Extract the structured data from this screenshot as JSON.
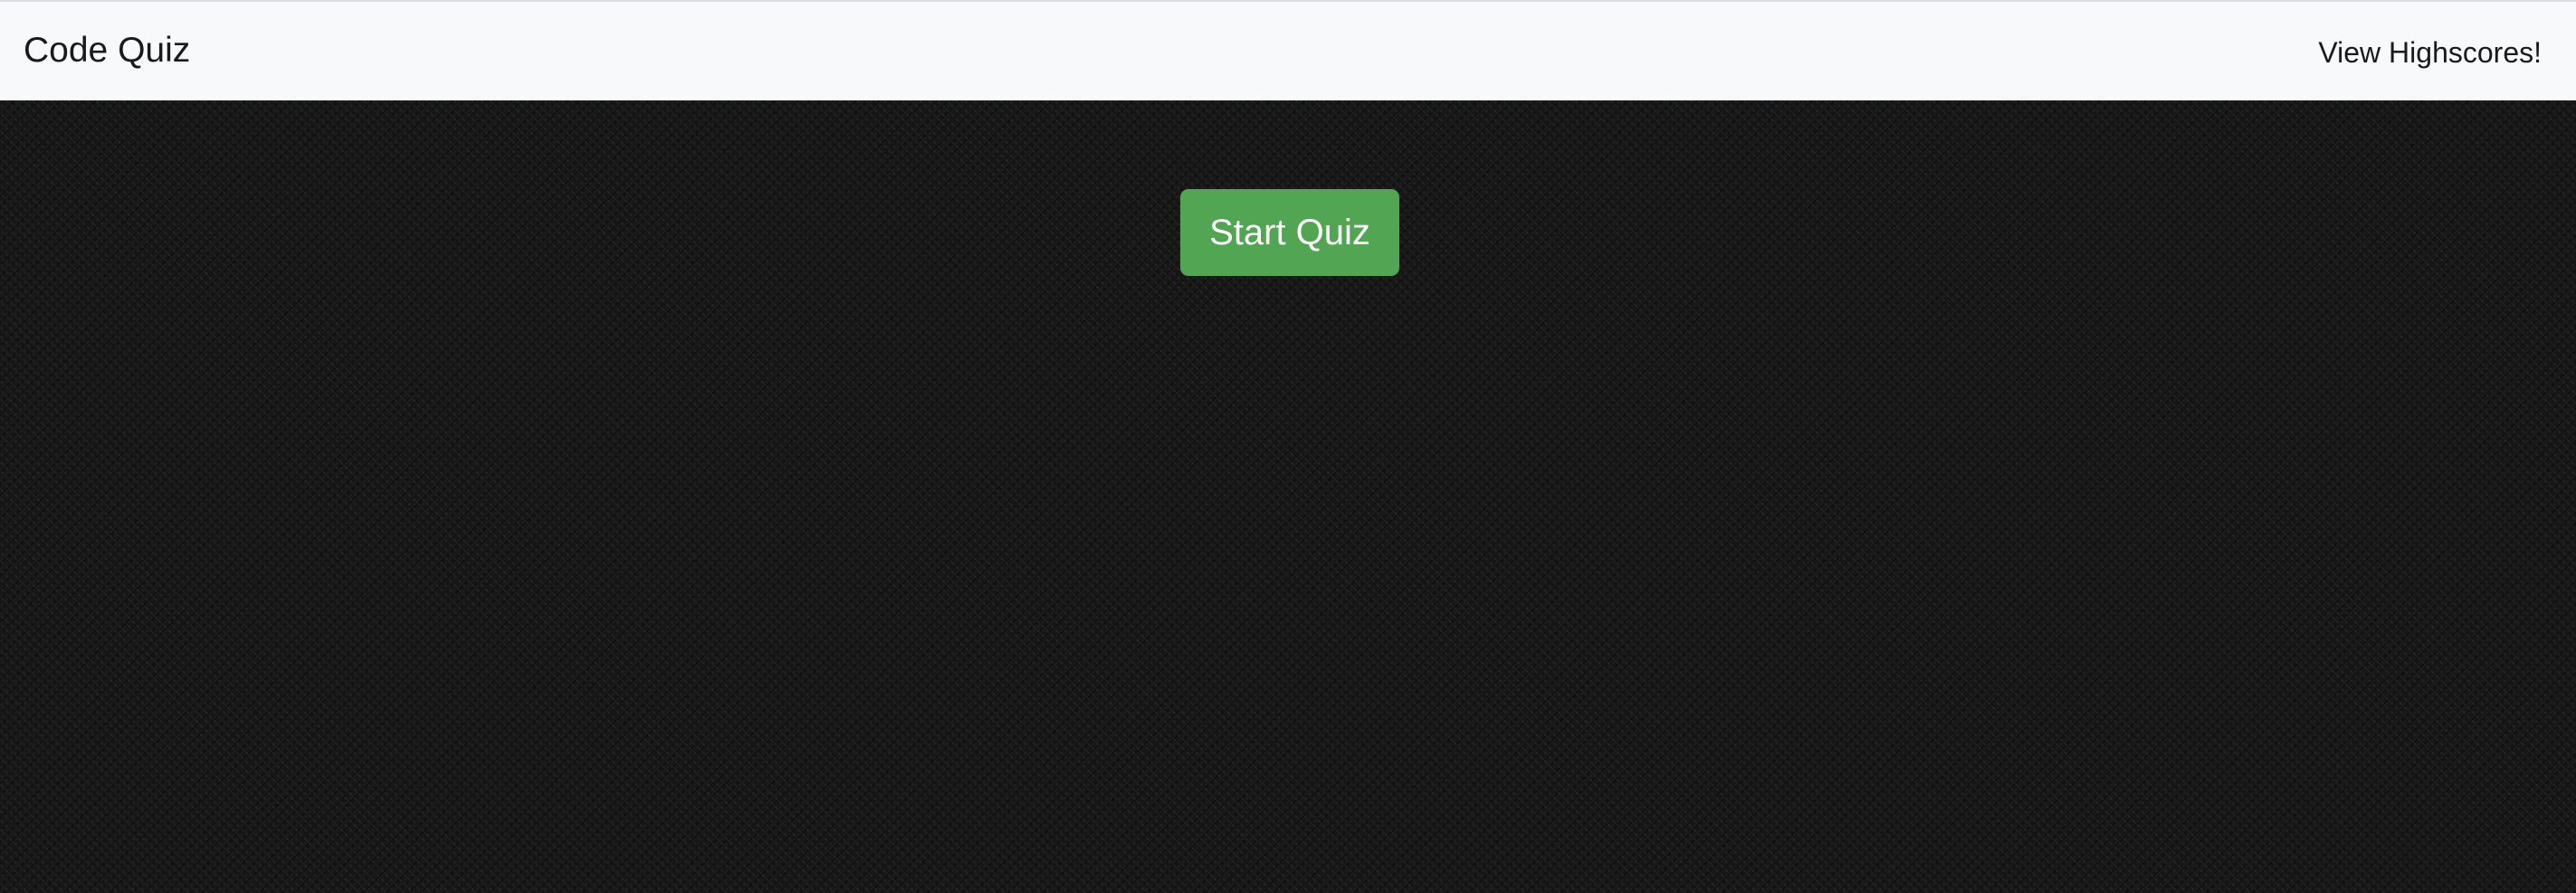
{
  "navbar": {
    "brand": "Code Quiz",
    "highscores_link": "View Highscores!"
  },
  "main": {
    "start_button": "Start Quiz"
  },
  "colors": {
    "navbar_bg": "#f8f9fa",
    "button_bg": "#52a552",
    "page_bg": "#161616"
  }
}
